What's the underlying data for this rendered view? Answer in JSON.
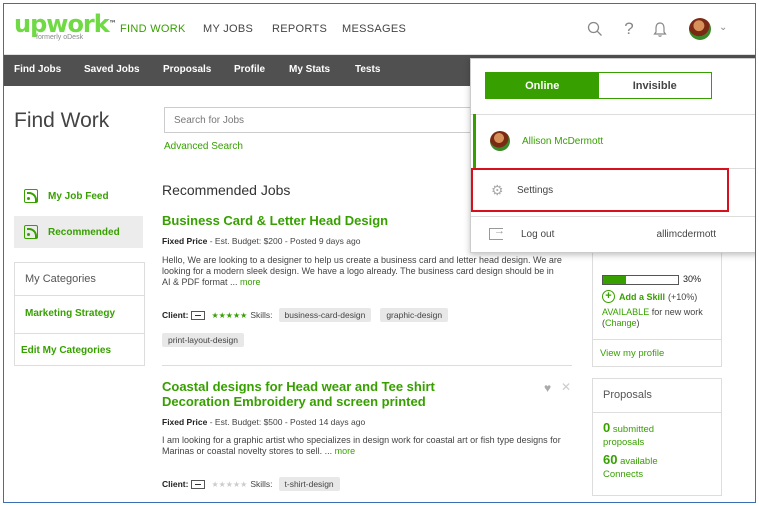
{
  "topnav": {
    "logo": "upwork",
    "logo_tm": "™",
    "logo_sub": "formerly oDesk",
    "links": [
      "FIND WORK",
      "MY JOBS",
      "REPORTS",
      "MESSAGES"
    ],
    "icons": [
      "search-icon",
      "help-icon",
      "bell-icon"
    ]
  },
  "subnav": [
    "Find Jobs",
    "Saved Jobs",
    "Proposals",
    "Profile",
    "My Stats",
    "Tests"
  ],
  "page_title": "Find Work",
  "search": {
    "placeholder": "Search for Jobs",
    "advanced": "Advanced Search"
  },
  "sidebar": {
    "feed": "My Job Feed",
    "recommended": "Recommended",
    "categories_title": "My Categories",
    "category": "Marketing Strategy",
    "edit": "Edit My Categories"
  },
  "recommended_title": "Recommended Jobs",
  "jobs": [
    {
      "title": "Business Card & Letter Head Design",
      "type": "Fixed Price",
      "meta": " - Est. Budget: $200 - Posted 9 days ago",
      "desc": "Hello, We are looking to a designer to help us create a business card and letter head design. We are looking for a modern sleek design. We have a logo already. The business card design should be in AI & PDF format ... ",
      "more": "more",
      "client": "Client:",
      "stars": "★★★★★",
      "skills_label": "Skills:",
      "skills": [
        "business-card-design",
        "graphic-design",
        "print-layout-design"
      ]
    },
    {
      "title_line1": "Coastal designs for Head wear and Tee shirt",
      "title_line2": "Decoration Embroidery and screen printed",
      "type": "Fixed Price",
      "meta": " - Est. Budget: $500 - Posted 14 days ago",
      "desc": "I am looking for a graphic artist who specializes in design work for coastal art or fish type designs for Marinas or coastal novelty stores to sell. ... ",
      "more": "more",
      "client": "Client:",
      "stars": "★★★★★",
      "skills_label": "Skills:",
      "skills": [
        "t-shirt-design"
      ]
    }
  ],
  "profile_box": {
    "progress": 0.3,
    "progress_label": "30%",
    "add_skill": "Add a Skill",
    "add_skill_bonus": "(+10%)",
    "available": "AVAILABLE",
    "available_rest": " for new work (",
    "change": "Change",
    "close_paren": ")",
    "view": "View my profile"
  },
  "proposals": {
    "title": "Proposals",
    "submitted_num": "0",
    "submitted_label": " submitted",
    "submitted_label2": "proposals",
    "connects_num": "60",
    "connects_label": " available",
    "connects_label2": "Connects"
  },
  "dropdown": {
    "online": "Online",
    "invisible": "Invisible",
    "user": "Allison McDermott",
    "settings": "Settings",
    "logout": "Log out",
    "username": "allimcdermott"
  },
  "colors": {
    "brand": "#37a000",
    "logo": "#6fda44",
    "subnav": "#505050",
    "highlight": "#d8101b"
  }
}
